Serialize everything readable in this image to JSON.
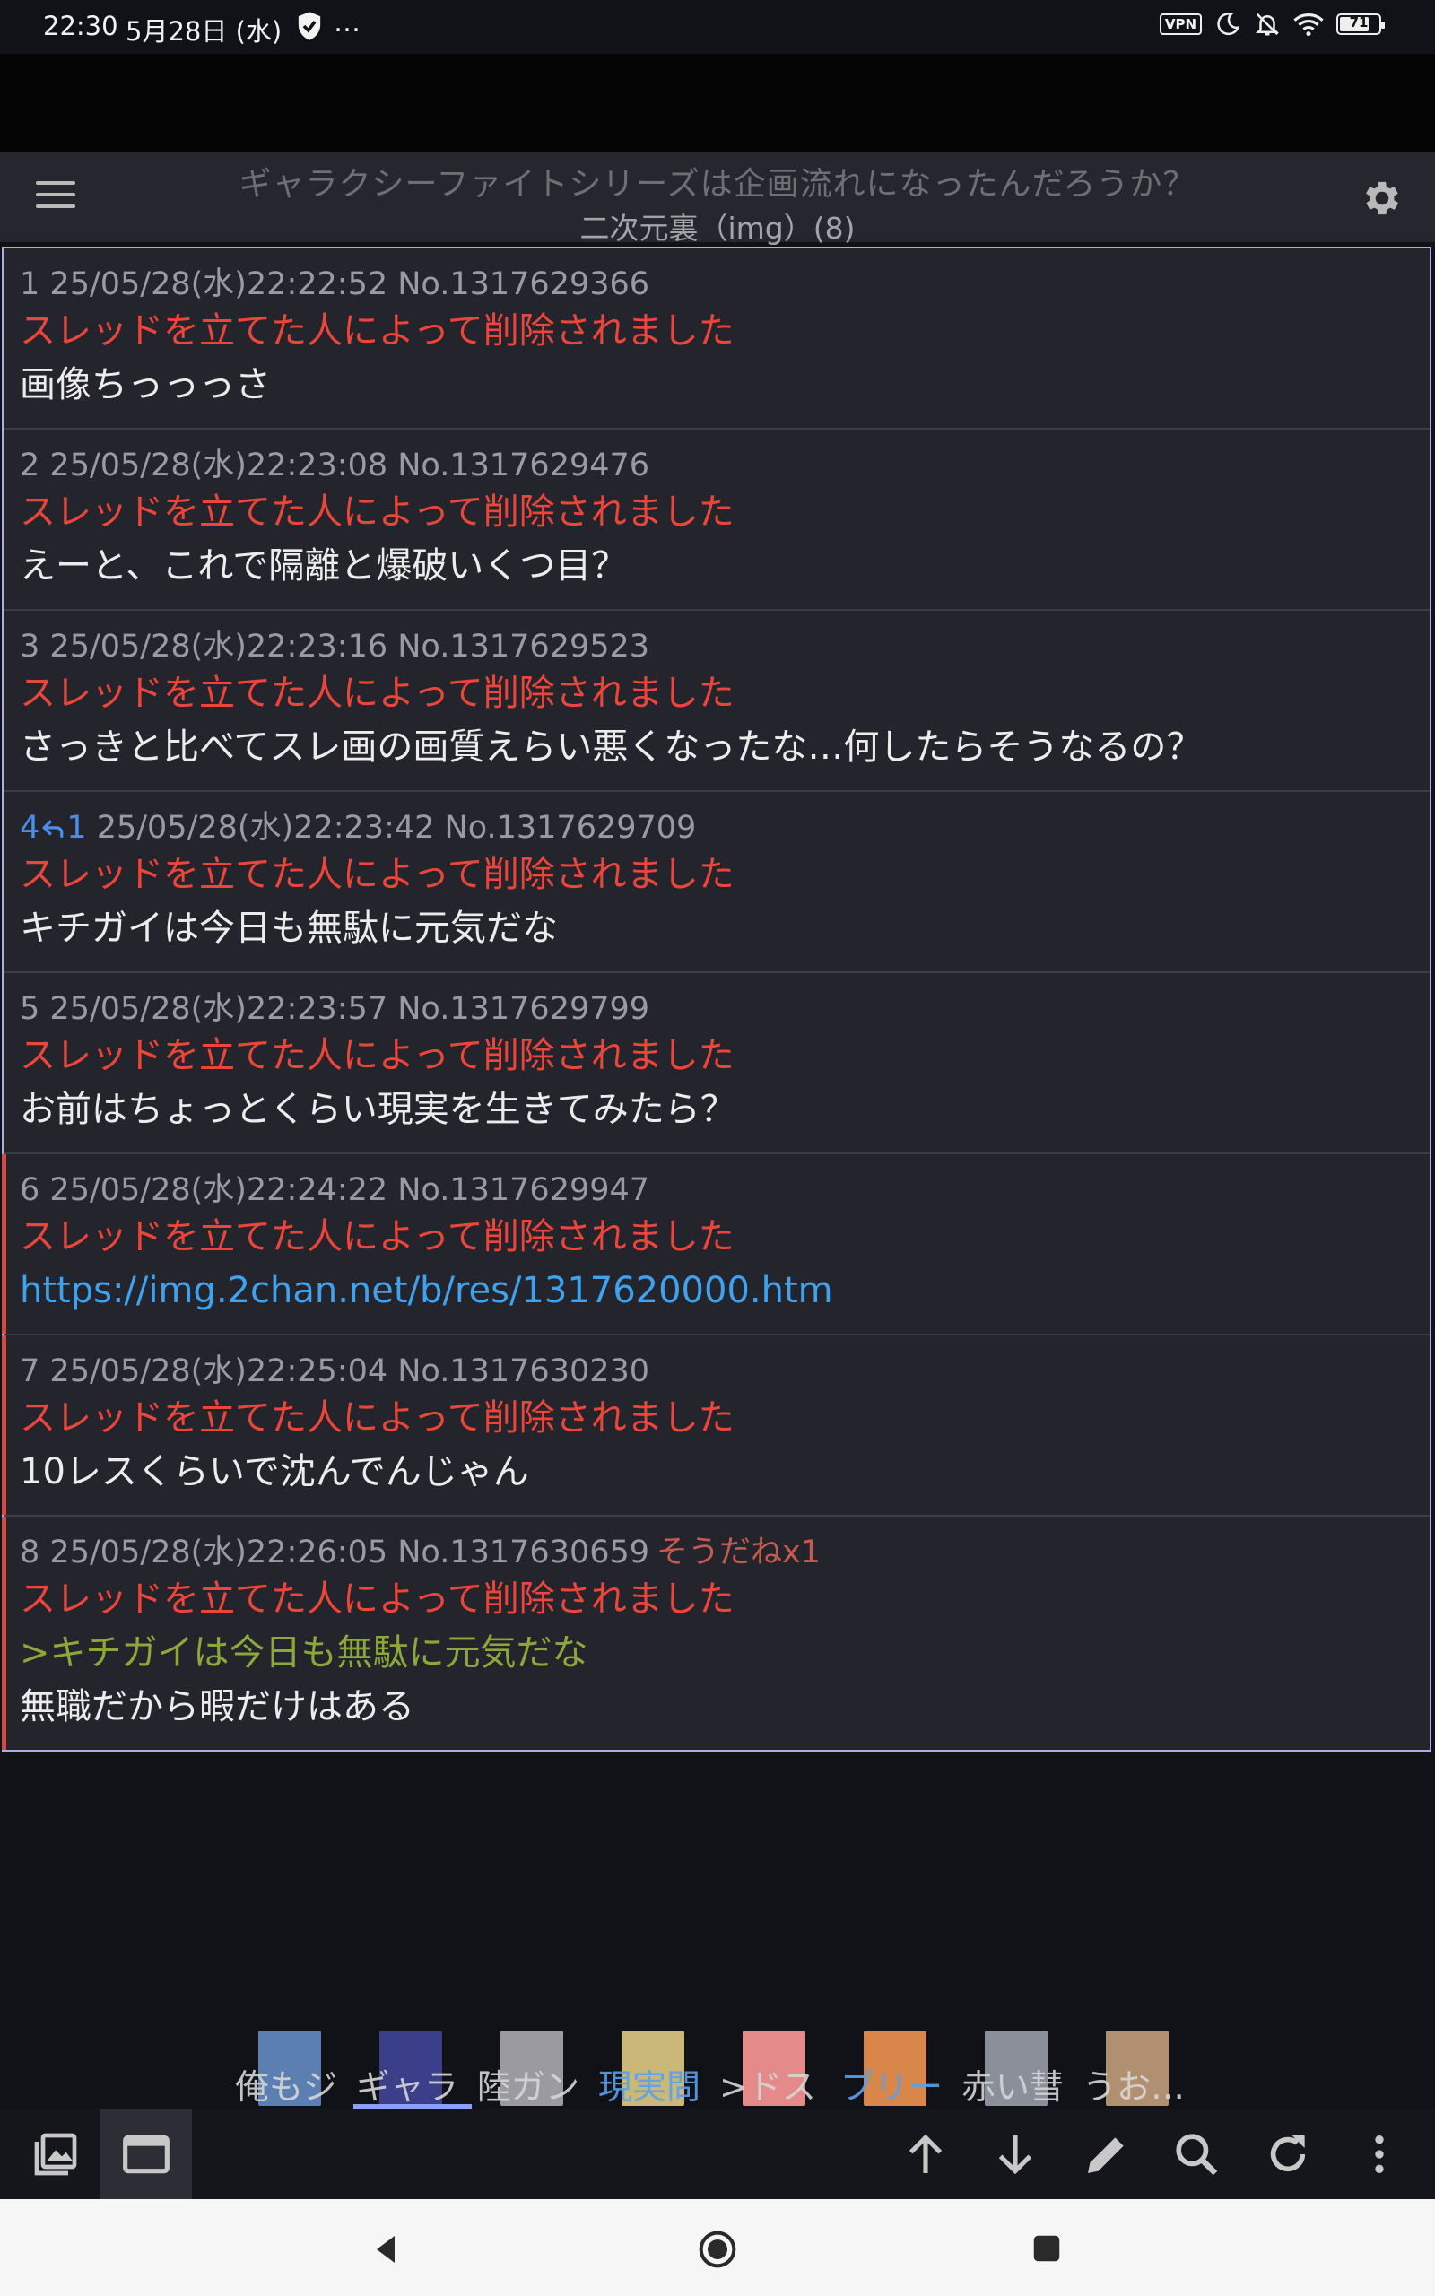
{
  "status_bar": {
    "time": "22:30",
    "date": "5月28日 (水)",
    "more": "…",
    "vpn": "VPN",
    "battery": "71",
    "icons": [
      "shield-icon",
      "vpn-icon",
      "moon-icon",
      "bell-off-icon",
      "wifi-icon",
      "battery-icon"
    ]
  },
  "toolbar": {
    "title": "ギャラクシーファイトシリーズは企画流れになったんだろうか？",
    "subtitle": "二次元裏（img）(8)"
  },
  "posts": [
    {
      "num": "1",
      "meta": "25/05/28(水)22:22:52 No.1317629366",
      "deleted": "スレッドを立てた人によって削除されました",
      "body": "画像ちっっっさ"
    },
    {
      "num": "2",
      "meta": "25/05/28(水)22:23:08 No.1317629476",
      "deleted": "スレッドを立てた人によって削除されました",
      "body": "えーと、これで隔離と爆破いくつ目？"
    },
    {
      "num": "3",
      "meta": "25/05/28(水)22:23:16 No.1317629523",
      "deleted": "スレッドを立てた人によって削除されました",
      "body": "さっきと比べてスレ画の画質えらい悪くなったな…何したらそうなるの？"
    },
    {
      "num": "4",
      "reply_to": "1",
      "meta": "25/05/28(水)22:23:42 No.1317629709",
      "deleted": "スレッドを立てた人によって削除されました",
      "body": "キチガイは今日も無駄に元気だな"
    },
    {
      "num": "5",
      "meta": "25/05/28(水)22:23:57 No.1317629799",
      "deleted": "スレッドを立てた人によって削除されました",
      "body": "お前はちょっとくらい現実を生きてみたら？"
    },
    {
      "num": "6",
      "meta": "25/05/28(水)22:24:22 No.1317629947",
      "deleted": "スレッドを立てた人によって削除されました",
      "link": "https://img.2chan.net/b/res/1317620000.htm"
    },
    {
      "num": "7",
      "meta": "25/05/28(水)22:25:04 No.1317630230",
      "deleted": "スレッドを立てた人によって削除されました",
      "body": "10レスくらいで沈んでんじゃん"
    },
    {
      "num": "8",
      "meta": "25/05/28(水)22:26:05 No.1317630659",
      "sodane": "そうだねx1",
      "deleted": "スレッドを立てた人によって削除されました",
      "quote": ">キチガイは今日も無駄に元気だな",
      "body": "無職だから暇だけはある"
    }
  ],
  "tabs": [
    {
      "label": "俺もジ",
      "color": "#5a7fb0"
    },
    {
      "label": "ギャラ",
      "color": "#3b3f8a",
      "active": true
    },
    {
      "label": "陸ガン",
      "color": "#9a9aa0"
    },
    {
      "label": "現実問",
      "color": "#c9b877",
      "blue": true
    },
    {
      "label": ">ドス",
      "color": "#e48a8a"
    },
    {
      "label": "ブリー",
      "color": "#d8864a",
      "blue": true
    },
    {
      "label": "赤い彗",
      "color": "#8a8f99"
    },
    {
      "label": "うお…",
      "color": "#b09070"
    }
  ],
  "actions": [
    "image-gallery-icon",
    "window-icon",
    "arrow-up-icon",
    "arrow-down-icon",
    "pencil-icon",
    "search-icon",
    "refresh-icon",
    "more-vert-icon"
  ],
  "nav": [
    "back-icon",
    "home-icon",
    "recents-icon"
  ]
}
